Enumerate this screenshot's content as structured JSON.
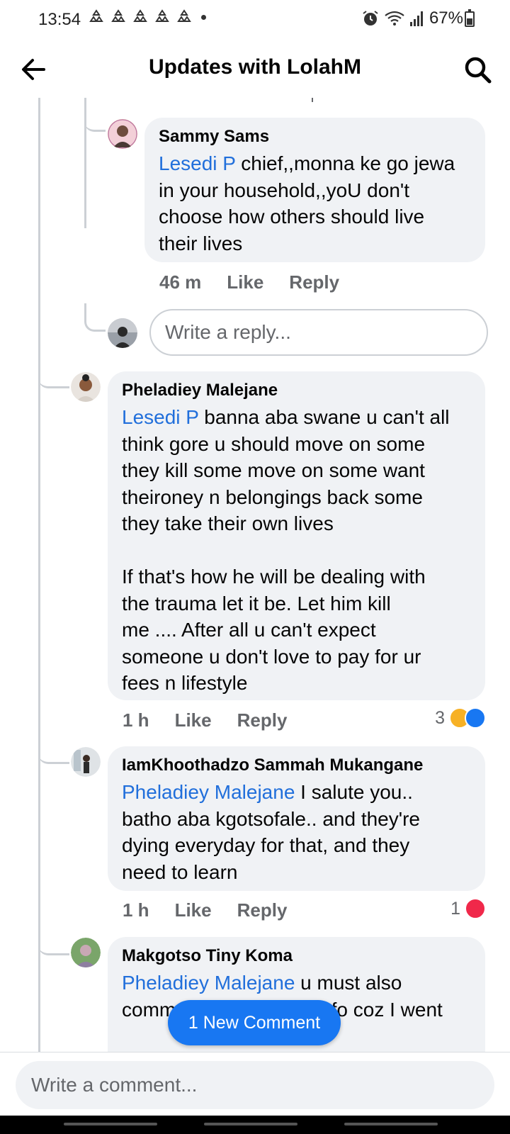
{
  "status_bar": {
    "time": "13:54",
    "battery": "67%",
    "notification_count": 5
  },
  "header": {
    "title": "Updates with LolahM",
    "back_icon": "arrow-left-icon",
    "search_icon": "search-icon"
  },
  "comments": [
    {
      "author": "Sammy Sams",
      "mention": "Lesedi P",
      "text": " chief,,monna ke go jewa\nin your household,,yoU don't\nchoose how others should live\ntheir lives",
      "time": "46 m",
      "like": "Like",
      "reply": "Reply"
    },
    {
      "author": "Pheladiey Malejane",
      "mention": "Lesedi P",
      "text": " banna aba swane u can't all\nthink gore u should move on some\nthey kill some move on some want\ntheironey n belongings back some\nthey take their own lives\n\nIf that's how he will be dealing with\nthe trauma let it be. Let him kill\nme .... After all u can't expect\nsomeone u don't love to pay for ur\nfees n lifestyle",
      "time": "1 h",
      "like": "Like",
      "reply": "Reply",
      "reaction_count": "3"
    },
    {
      "author": "IamKhoothadzo Sammah Mukangane",
      "mention": "Pheladiey Malejane",
      "text": " I salute you..\nbatho aba kgotsofale.. and they're\ndying everyday for that, and they\nneed to learn",
      "time": "1 h",
      "like": "Like",
      "reply": "Reply",
      "reaction_count": "1"
    },
    {
      "author": "Makgotso Tiny Koma",
      "mention": "Pheladiey Malejane",
      "text": " u must also\ncomment with correct info coz I went",
      "time": "",
      "like": "",
      "reply": ""
    }
  ],
  "reply_input": {
    "placeholder": "Write a reply..."
  },
  "new_comment_pill": {
    "label": "1 New Comment"
  },
  "composer": {
    "placeholder": "Write a comment..."
  },
  "colors": {
    "accent": "#1877f2",
    "mention": "#216fdb",
    "bubble": "#f0f2f5",
    "love": "#f0284a"
  }
}
